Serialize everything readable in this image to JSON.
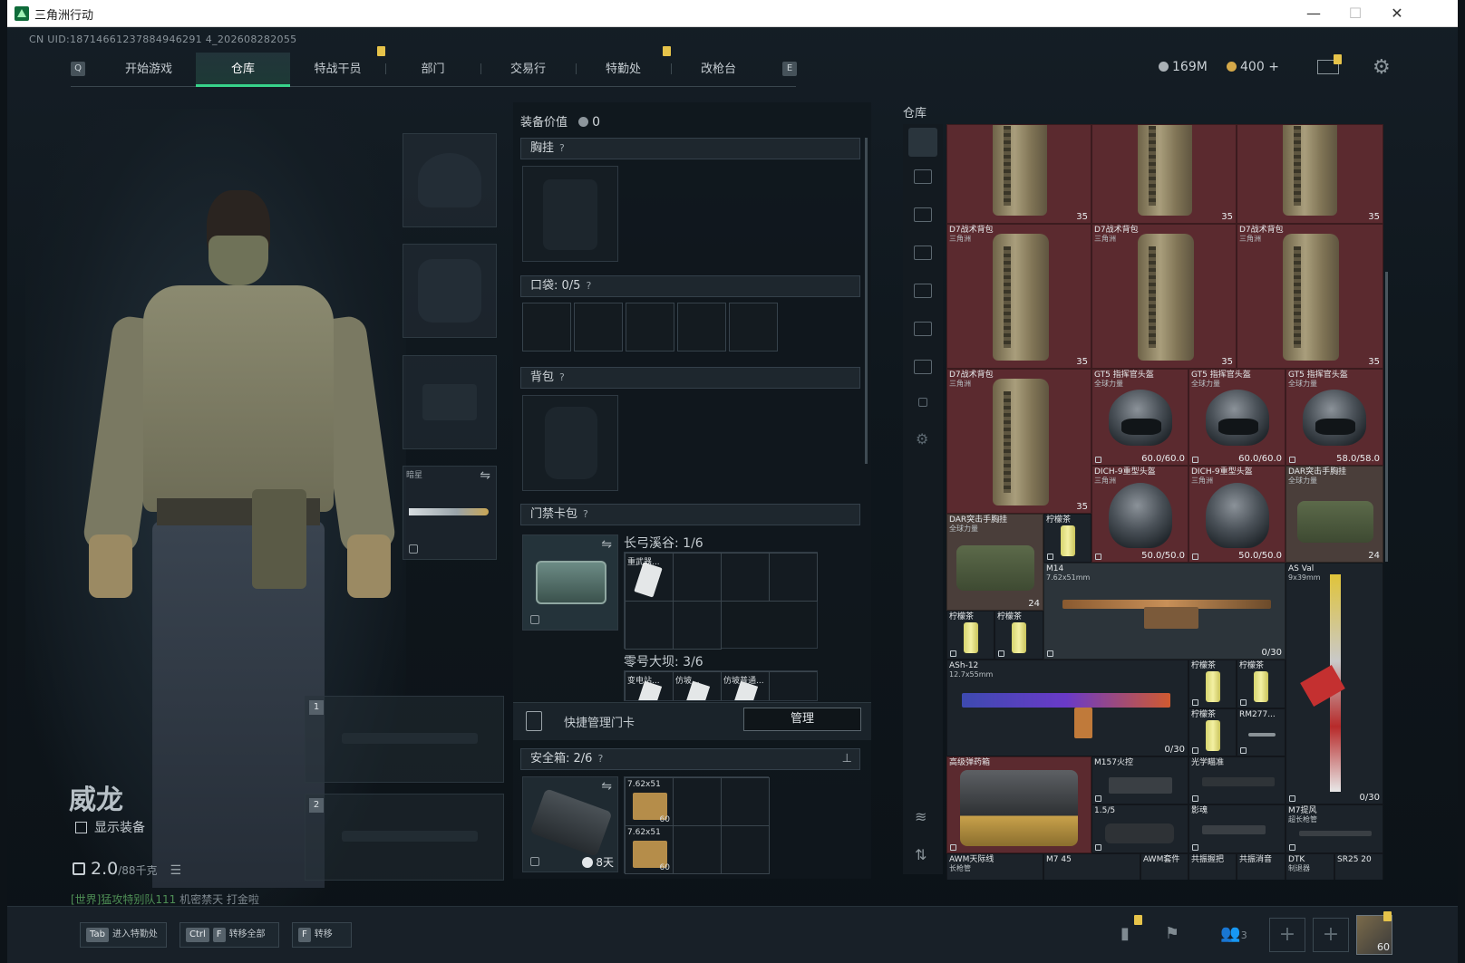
{
  "window": {
    "title": "三角洲行动",
    "min": "—",
    "max": "☐",
    "close": "✕"
  },
  "uid": "CN UID:18714661237884946291 4_202608282055",
  "nav": {
    "left_key": "Q",
    "right_key": "E",
    "tabs": [
      "开始游戏",
      "仓库",
      "特战干员",
      "部门",
      "交易行",
      "特勤处",
      "改枪台"
    ],
    "active": "仓库"
  },
  "currency": {
    "silver": "169M",
    "gold": "400",
    "gold_plus": "+"
  },
  "character": {
    "name": "威龙",
    "show_equip": "显示装备",
    "weight": "2.0",
    "weight_max": "/88千克",
    "chat_channel": "[世界]",
    "chat_sender": "猛攻特别队111",
    "chat_msg": "机密禁天 打金啦"
  },
  "slots": {
    "melee_label": "暗星"
  },
  "middle": {
    "equip_value_label": "装备价值",
    "equip_value": "0",
    "chest_rig": "胸挂",
    "pocket_label": "口袋:",
    "pocket_count": "0/5",
    "backpack": "背包",
    "keycard": "门禁卡包",
    "map1": "长弓溪谷: 1/6",
    "map2": "零号大坝: 3/6",
    "key_small": "重武器...",
    "key2": "变电站...",
    "key3": "仿坡...",
    "key4": "仿坡普通...",
    "quick_manage": "快捷管理门卡",
    "manage_btn": "管理",
    "safebox_label": "安全箱:",
    "safebox_count": "2/6",
    "safe_timer": "8天",
    "ammo1": "7.62x51",
    "ammo2": "7.62x51",
    "ammo_count": "60",
    "help": "?"
  },
  "warehouse": {
    "title": "仓库",
    "items": [
      {
        "name": "",
        "sub": "",
        "count": "35"
      },
      {
        "name": "",
        "sub": "",
        "count": "35"
      },
      {
        "name": "",
        "sub": "",
        "count": "35"
      },
      {
        "name": "D7战术背包",
        "sub": "三角洲",
        "count": "35"
      },
      {
        "name": "D7战术背包",
        "sub": "三角洲",
        "count": "35"
      },
      {
        "name": "D7战术背包",
        "sub": "三角洲",
        "count": "35"
      },
      {
        "name": "D7战术背包",
        "sub": "三角洲",
        "count": "35"
      },
      {
        "name": "GT5 指挥官头盔",
        "sub": "全球力量",
        "count": "60.0/60.0"
      },
      {
        "name": "GT5 指挥官头盔",
        "sub": "全球力量",
        "count": "60.0/60.0"
      },
      {
        "name": "GT5 指挥官头盔",
        "sub": "全球力量",
        "count": "58.0/58.0"
      },
      {
        "name": "DICH-9重型头盔",
        "sub": "三角洲",
        "count": "50.0/50.0"
      },
      {
        "name": "DICH-9重型头盔",
        "sub": "三角洲",
        "count": "50.0/50.0"
      },
      {
        "name": "DAR突击手胸挂",
        "sub": "全球力量",
        "count": "24"
      },
      {
        "name": "DAR突击手胸挂",
        "sub": "全球力量",
        "count": "24"
      },
      {
        "name": "柠檬茶",
        "sub": "",
        "count": ""
      },
      {
        "name": "M14",
        "sub": "7.62x51mm",
        "count": "0/30"
      },
      {
        "name": "AS Val",
        "sub": "9x39mm",
        "count": "0/30"
      },
      {
        "name": "柠檬茶",
        "sub": "",
        "count": ""
      },
      {
        "name": "柠檬茶",
        "sub": "",
        "count": ""
      },
      {
        "name": "ASh-12",
        "sub": "12.7x55mm",
        "count": "0/30"
      },
      {
        "name": "柠檬茶",
        "sub": "",
        "count": ""
      },
      {
        "name": "柠檬茶",
        "sub": "",
        "count": ""
      },
      {
        "name": "柠檬茶",
        "sub": "",
        "count": ""
      },
      {
        "name": "RM277...",
        "sub": "",
        "count": ""
      },
      {
        "name": "高级弹药箱",
        "sub": "",
        "count": ""
      },
      {
        "name": "M157火控",
        "sub": "",
        "count": ""
      },
      {
        "name": "光学瞄准",
        "sub": "",
        "count": ""
      },
      {
        "name": "1.5/5",
        "sub": "",
        "count": ""
      },
      {
        "name": "影魂",
        "sub": "",
        "count": ""
      },
      {
        "name": "M7提风",
        "sub": "超长枪管",
        "count": ""
      },
      {
        "name": "AWM天际线",
        "sub": "长枪管",
        "count": ""
      },
      {
        "name": "M7 45",
        "sub": "",
        "count": ""
      },
      {
        "name": "AWM套件",
        "sub": "",
        "count": ""
      },
      {
        "name": "共振握把",
        "sub": "",
        "count": ""
      },
      {
        "name": "共振消音",
        "sub": "",
        "count": ""
      },
      {
        "name": "DTK",
        "sub": "制退器",
        "count": ""
      },
      {
        "name": "SR25 20",
        "sub": "",
        "count": ""
      }
    ]
  },
  "bottom": {
    "hk1_key": "Tab",
    "hk1_label": "进入特勤处",
    "hk2_key1": "Ctrl",
    "hk2_key2": "F",
    "hk2_label": "转移全部",
    "hk3_key": "F",
    "hk3_label": "转移",
    "team_count": "3",
    "avatar_level": "60"
  }
}
